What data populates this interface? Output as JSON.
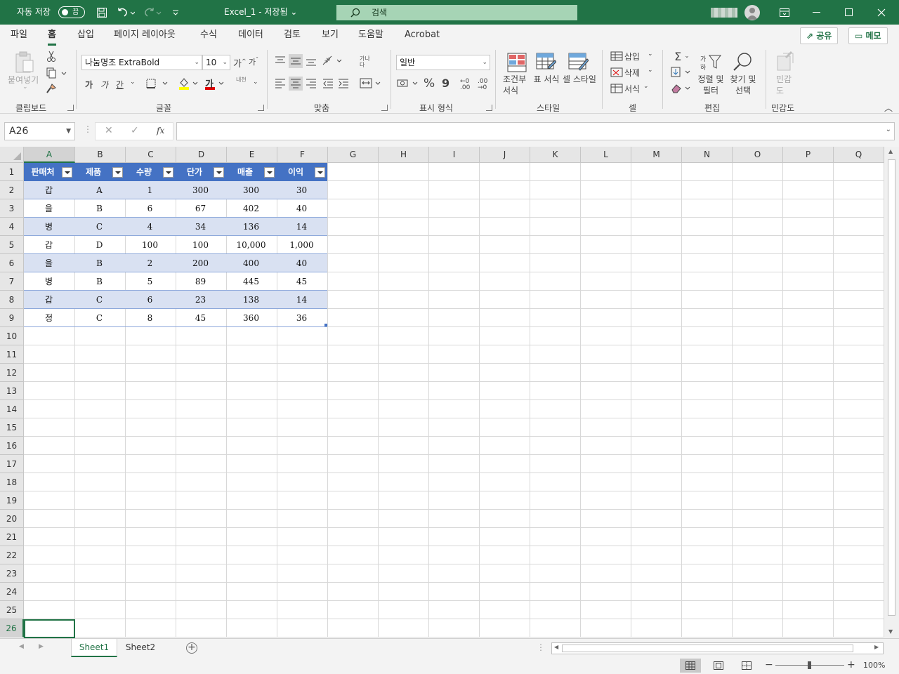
{
  "titlebar": {
    "autosave_label": "자동 저장",
    "autosave_state": "끔",
    "doc_title": "Excel_1 - 저장됨 ⌄",
    "search_placeholder": "검색"
  },
  "ribbon_tabs": [
    "파일",
    "홈",
    "삽입",
    "페이지 레이아웃",
    "수식",
    "데이터",
    "검토",
    "보기",
    "도움말",
    "Acrobat"
  ],
  "active_tab": "홈",
  "share_label": "공유",
  "memo_label": "메모",
  "clipboard": {
    "paste_label": "붙여넣기",
    "group_label": "클립보드"
  },
  "font": {
    "name": "나눔명조 ExtraBold",
    "size": "10",
    "grow": "가",
    "shrink": "가",
    "bold": "가",
    "italic": "가",
    "underline": "간",
    "color_letter": "가",
    "phonetic": "내천",
    "group_label": "글꼴"
  },
  "alignment": {
    "group_label": "맞춤",
    "wrap_label": "가나다"
  },
  "number": {
    "format": "일반",
    "group_label": "표시 형식",
    "percent": "%",
    "comma": "9"
  },
  "styles": {
    "cond_format": "조건부 서식",
    "format_table": "표 서식",
    "cell_styles": "셀 스타일",
    "group_label": "스타일"
  },
  "cells": {
    "insert": "삽입",
    "delete": "삭제",
    "format": "서식",
    "group_label": "셀"
  },
  "editing": {
    "sort_filter": "정렬 및 필터",
    "find_select": "찾기 및 선택",
    "group_label": "편집"
  },
  "sensitivity": {
    "label": "민감도",
    "group_label": "민감도"
  },
  "formula_bar": {
    "name_box": "A26",
    "fx": "fx",
    "formula": ""
  },
  "columns": [
    "A",
    "B",
    "C",
    "D",
    "E",
    "F",
    "G",
    "H",
    "I",
    "J",
    "K",
    "L",
    "M",
    "N",
    "O",
    "P",
    "Q"
  ],
  "selected_column": "A",
  "rows": [
    "1",
    "2",
    "3",
    "4",
    "5",
    "6",
    "7",
    "8",
    "9",
    "10",
    "11",
    "12",
    "13",
    "14",
    "15",
    "16",
    "17",
    "18",
    "19",
    "20",
    "21",
    "22",
    "23",
    "24",
    "25",
    "26"
  ],
  "selected_row": "26",
  "table": {
    "headers": [
      "판매처",
      "제품",
      "수량",
      "단가",
      "매출",
      "이익"
    ],
    "rows": [
      [
        "갑",
        "A",
        "1",
        "300",
        "300",
        "30"
      ],
      [
        "을",
        "B",
        "6",
        "67",
        "402",
        "40"
      ],
      [
        "병",
        "C",
        "4",
        "34",
        "136",
        "14"
      ],
      [
        "갑",
        "D",
        "100",
        "100",
        "10,000",
        "1,000"
      ],
      [
        "을",
        "B",
        "2",
        "200",
        "400",
        "40"
      ],
      [
        "병",
        "B",
        "5",
        "89",
        "445",
        "45"
      ],
      [
        "갑",
        "C",
        "6",
        "23",
        "138",
        "14"
      ],
      [
        "정",
        "C",
        "8",
        "45",
        "360",
        "36"
      ]
    ],
    "header_color": "#4472C4",
    "band_color": "#D9E1F2"
  },
  "sheets": [
    "Sheet1",
    "Sheet2"
  ],
  "active_sheet": "Sheet1",
  "zoom": "100%",
  "accent_color": "#217346"
}
